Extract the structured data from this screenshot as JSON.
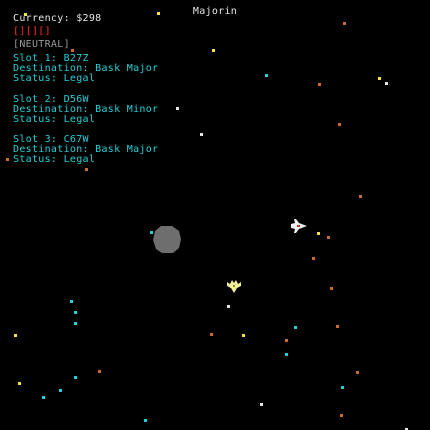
{
  "location": "Majorin",
  "hud": {
    "currency_label": "Currency:",
    "currency_value": "$298",
    "health_boxes": "[][][]",
    "standing": "[NEUTRAL]"
  },
  "cargo_slots": [
    {
      "slot_label": "Slot 1: B27Z",
      "destination_label": "Destination: Bask Major",
      "status_label": "Status: Legal"
    },
    {
      "slot_label": "Slot 2: D56W",
      "destination_label": "Destination: Bask Minor",
      "status_label": "Status: Legal"
    },
    {
      "slot_label": "Slot 3: C67W",
      "destination_label": "Destination: Bask Major",
      "status_label": "Status: Legal"
    }
  ],
  "colors": {
    "background": "#000000",
    "hud_text": "#e6e6e6",
    "health": "#ff2a2a",
    "standing": "#9a9a9a",
    "cargo_text": "#20d0d8",
    "asteroid": "#6e6e6e",
    "player_ship": "#f0f0f0",
    "enemy_ship": "#f2f29a"
  },
  "sprites": {
    "player_ship": "player-ship-icon",
    "enemy_ship": "enemy-ship-icon",
    "asteroid": "asteroid-icon"
  }
}
